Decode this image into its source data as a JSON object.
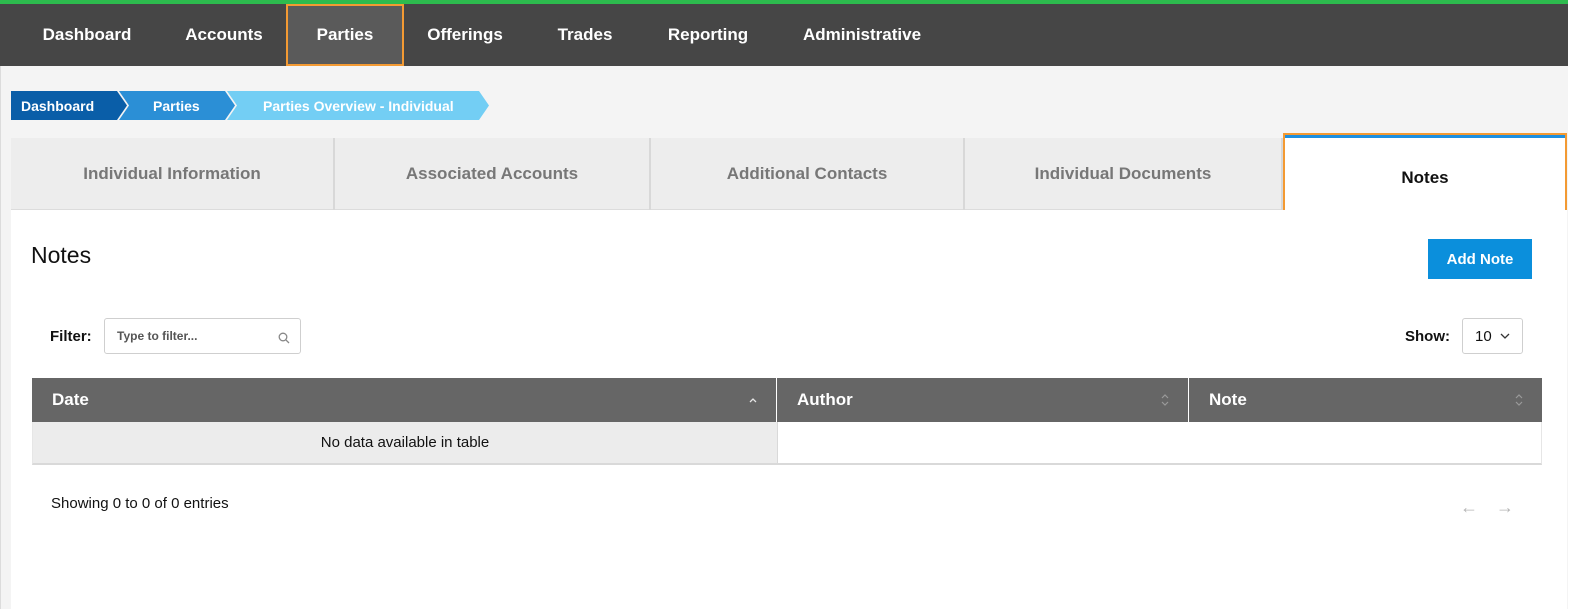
{
  "colors": {
    "nav_bg": "#464646",
    "nav_top_border": "#2dbb4e",
    "highlight_outline": "#f39a33",
    "breadcrumb_1": "#0a5ea8",
    "breadcrumb_2": "#2b8fd6",
    "breadcrumb_3": "#73cef4",
    "active_tab_accent": "#1e8fe0",
    "primary_button": "#0b8fdc",
    "table_header": "#666666"
  },
  "topnav": {
    "items": [
      {
        "label": "Dashboard"
      },
      {
        "label": "Accounts"
      },
      {
        "label": "Parties",
        "active": true
      },
      {
        "label": "Offerings"
      },
      {
        "label": "Trades"
      },
      {
        "label": "Reporting"
      },
      {
        "label": "Administrative"
      }
    ]
  },
  "breadcrumb": {
    "items": [
      {
        "label": "Dashboard"
      },
      {
        "label": "Parties"
      },
      {
        "label": "Parties Overview - Individual"
      }
    ]
  },
  "tabs": [
    {
      "label": "Individual Information"
    },
    {
      "label": "Associated Accounts"
    },
    {
      "label": "Additional Contacts"
    },
    {
      "label": "Individual Documents"
    },
    {
      "label": "Notes",
      "active": true
    }
  ],
  "panel": {
    "title": "Notes",
    "add_button_label": "Add Note",
    "filter": {
      "label": "Filter:",
      "placeholder": "Type to filter...",
      "value": "",
      "icon": "search-icon"
    },
    "show": {
      "label": "Show:",
      "value": "10"
    },
    "table": {
      "columns": [
        {
          "label": "Date",
          "sort": "asc"
        },
        {
          "label": "Author",
          "sort": "none"
        },
        {
          "label": "Note",
          "sort": "none"
        }
      ],
      "empty_message": "No data available in table"
    },
    "info": "Showing 0 to 0 of 0 entries",
    "pager": {
      "prev": "←",
      "next": "→"
    }
  }
}
